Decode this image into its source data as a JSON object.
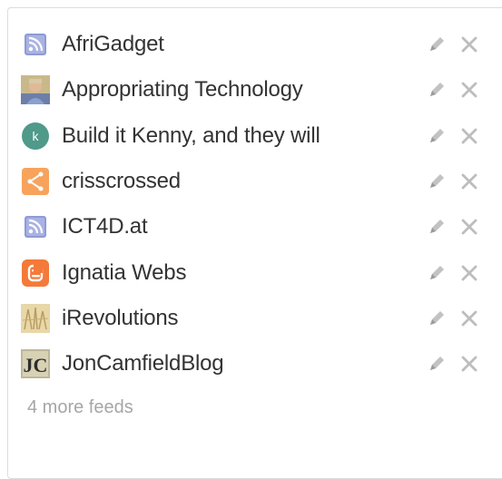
{
  "colors": {
    "rss": "#8e9bd6",
    "avatar_k": "#4f9a8a",
    "orange_share": "#f7a35c",
    "blogger": "#f47a3a",
    "text": "#333333",
    "muted": "#a6a6a6",
    "action_icon": "#bdbdbd"
  },
  "feeds": [
    {
      "label": "AfriGadget",
      "icon": "rss-icon"
    },
    {
      "label": "Appropriating Technology",
      "icon": "person-photo-icon"
    },
    {
      "label": "Build it Kenny, and they will",
      "icon": "letter-avatar-icon",
      "avatar_letter": "k"
    },
    {
      "label": "crisscrossed",
      "icon": "share-icon"
    },
    {
      "label": "ICT4D.at",
      "icon": "rss-icon"
    },
    {
      "label": "Ignatia Webs",
      "icon": "blogger-icon"
    },
    {
      "label": "iRevolutions",
      "icon": "sketch-image-icon"
    },
    {
      "label": "JonCamfieldBlog",
      "icon": "jc-logo-icon",
      "logo_text": "JC"
    }
  ],
  "more_feeds": "4 more feeds"
}
